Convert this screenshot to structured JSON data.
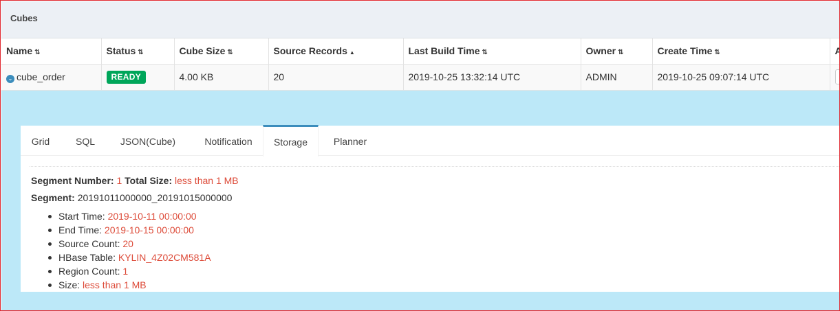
{
  "panel": {
    "title": "Cubes"
  },
  "table": {
    "columns": [
      {
        "label": "Name",
        "sort": "both"
      },
      {
        "label": "Status",
        "sort": "both"
      },
      {
        "label": "Cube Size",
        "sort": "both"
      },
      {
        "label": "Source Records",
        "sort": "asc"
      },
      {
        "label": "Last Build Time",
        "sort": "both"
      },
      {
        "label": "Owner",
        "sort": "both"
      },
      {
        "label": "Create Time",
        "sort": "both"
      },
      {
        "label": "A",
        "sort": "none"
      }
    ],
    "row": {
      "name": "cube_order",
      "status": "READY",
      "cube_size": "4.00 KB",
      "source_records": "20",
      "last_build_time": "2019-10-25 13:32:14 UTC",
      "owner": "ADMIN",
      "create_time": "2019-10-25 09:07:14 UTC"
    }
  },
  "tabs": [
    "Grid",
    "SQL",
    "JSON(Cube)",
    "Notification",
    "Storage",
    "Planner"
  ],
  "active_tab": "Storage",
  "storage": {
    "segment_number_label": "Segment Number:",
    "segment_number": "1",
    "total_size_label": "Total Size:",
    "total_size": "less than 1 MB",
    "segment_label": "Segment:",
    "segment_name": "20191011000000_20191015000000",
    "details": [
      {
        "label": "Start Time:",
        "value": "2019-10-11 00:00:00"
      },
      {
        "label": "End Time:",
        "value": "2019-10-15 00:00:00"
      },
      {
        "label": "Source Count:",
        "value": "20"
      },
      {
        "label": "HBase Table:",
        "value": "KYLIN_4Z02CM581A"
      },
      {
        "label": "Region Count:",
        "value": "1"
      },
      {
        "label": "Size:",
        "value": "less than 1 MB"
      }
    ]
  },
  "colors": {
    "accent": "#3c8dbc",
    "ready": "#00a65a",
    "value_red": "#dd4b39",
    "detail_bg": "#bce8f8",
    "header_bg": "#ecf0f5"
  }
}
